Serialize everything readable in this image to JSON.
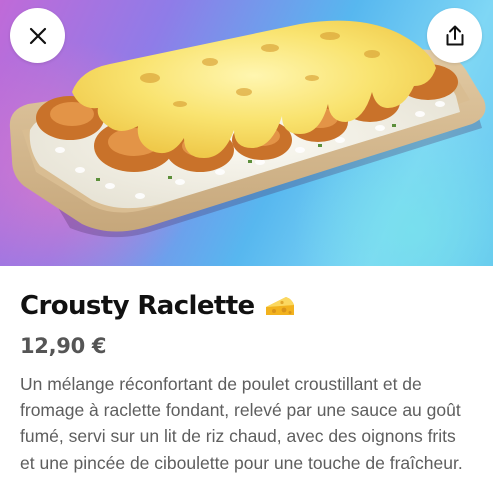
{
  "product": {
    "name": "Crousty Raclette",
    "price": "12,90 €",
    "description": "Un mélange réconfortant de poulet croustillant et de fromage à raclette fondant, relevé par une sauce au goût fumé, servi sur un lit de riz chaud, avec des oignons frits et une pincée de ciboulette pour une touche de fraîcheur."
  },
  "icons": {
    "close": "close-icon",
    "share": "share-icon",
    "cheese": "cheese-emoji-icon"
  },
  "colors": {
    "title": "#111111",
    "price": "#555555",
    "description": "#5e5e5e",
    "hero_gradient_start": "#c06ad8",
    "hero_gradient_end": "#64c6ef"
  }
}
